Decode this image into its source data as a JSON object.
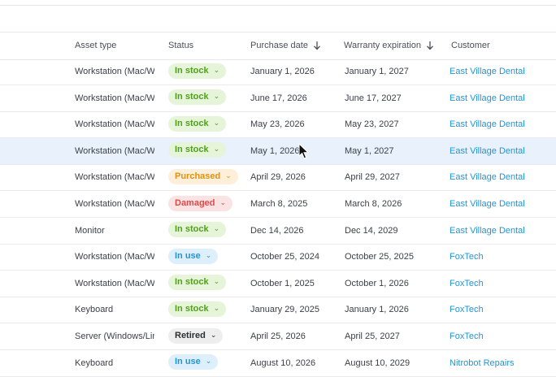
{
  "columns": {
    "asset_type": "Asset type",
    "status": "Status",
    "purchase_date": "Purchase date",
    "warranty_expiration": "Warranty expiration",
    "customer": "Customer"
  },
  "rows": [
    {
      "asset_type": "Workstation (Mac/Win",
      "status": "In stock",
      "status_kind": "instock",
      "purchase_date": "January 1, 2026",
      "warranty_expiration": "January 1, 2027",
      "customer": "East Village Dental"
    },
    {
      "asset_type": "Workstation (Mac/Win",
      "status": "In stock",
      "status_kind": "instock",
      "purchase_date": "June 17, 2026",
      "warranty_expiration": "June 17, 2027",
      "customer": "East Village Dental"
    },
    {
      "asset_type": "Workstation (Mac/Win",
      "status": "In stock",
      "status_kind": "instock",
      "purchase_date": "May 23, 2026",
      "warranty_expiration": "May 23, 2027",
      "customer": "East Village Dental"
    },
    {
      "asset_type": "Workstation (Mac/Win",
      "status": "In stock",
      "status_kind": "instock",
      "purchase_date": "May 1, 2026",
      "warranty_expiration": "May 1, 2027",
      "customer": "East Village Dental",
      "selected": true
    },
    {
      "asset_type": "Workstation (Mac/Win",
      "status": "Purchased",
      "status_kind": "purchased",
      "purchase_date": "April 29, 2026",
      "warranty_expiration": "April 29, 2027",
      "customer": "East Village Dental"
    },
    {
      "asset_type": "Workstation (Mac/Win",
      "status": "Damaged",
      "status_kind": "damaged",
      "purchase_date": "March 8, 2025",
      "warranty_expiration": "March 8, 2026",
      "customer": "East Village Dental"
    },
    {
      "asset_type": "Monitor",
      "status": "In stock",
      "status_kind": "instock",
      "purchase_date": "Dec 14, 2026",
      "warranty_expiration": "Dec 14, 2029",
      "customer": "East Village Dental"
    },
    {
      "asset_type": "Workstation (Mac/Win",
      "status": "In use",
      "status_kind": "inuse",
      "purchase_date": "October 25, 2024",
      "warranty_expiration": "October 25, 2025",
      "customer": "FoxTech"
    },
    {
      "asset_type": "Workstation (Mac/Win",
      "status": "In stock",
      "status_kind": "instock",
      "purchase_date": "October 1, 2025",
      "warranty_expiration": "October 1, 2026",
      "customer": "FoxTech"
    },
    {
      "asset_type": "Keyboard",
      "status": "In stock",
      "status_kind": "instock",
      "purchase_date": "January 29, 2025",
      "warranty_expiration": "January 1, 2026",
      "customer": "FoxTech"
    },
    {
      "asset_type": "Server (Windows/Linu",
      "status": "Retired",
      "status_kind": "retired",
      "purchase_date": "April 25, 2026",
      "warranty_expiration": "April 25, 2027",
      "customer": "FoxTech"
    },
    {
      "asset_type": "Keyboard",
      "status": "In use",
      "status_kind": "inuse",
      "purchase_date": "August 10, 2026",
      "warranty_expiration": "August 10, 2029",
      "customer": "Nitrobot Repairs"
    }
  ],
  "colors": {
    "link": "#2196d6",
    "selected_row": "#e8f1fc",
    "in_stock": "#4ea316",
    "purchased": "#e0920f",
    "damaged": "#e04848",
    "in_use": "#2196d6",
    "retired": "#2d2f33"
  },
  "icons": {
    "sort": "arrow-down-icon",
    "dropdown": "chevron-down-icon",
    "cursor": "mouse-pointer-icon"
  }
}
